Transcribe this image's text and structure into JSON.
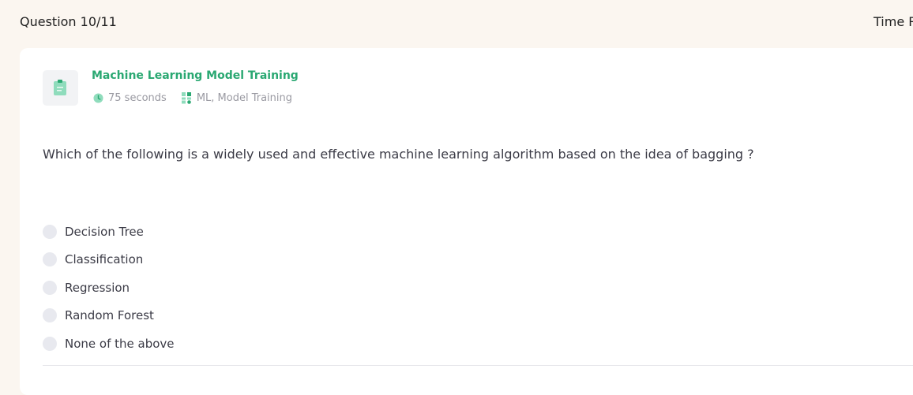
{
  "header": {
    "question_counter": "Question 10/11",
    "time_label": "Time R"
  },
  "question": {
    "title": "Machine Learning Model Training",
    "duration": "75 seconds",
    "tags": "ML, Model Training",
    "text": "Which of the following is a widely used and effective machine learning algorithm based on the idea of bagging ?",
    "options": [
      {
        "label": "Decision Tree"
      },
      {
        "label": "Classification"
      },
      {
        "label": "Regression"
      },
      {
        "label": "Random Forest"
      },
      {
        "label": "None of the above"
      }
    ]
  },
  "colors": {
    "accent": "#2aa872",
    "background": "#fbf6f0",
    "card": "#ffffff",
    "radio": "#e8e9ef"
  },
  "icons": {
    "question": "clipboard-icon",
    "duration": "clock-icon",
    "tags": "tags-icon"
  }
}
